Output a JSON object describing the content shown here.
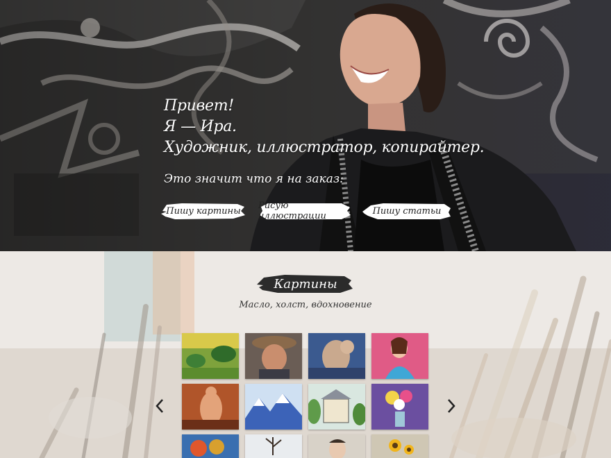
{
  "hero": {
    "greeting": "Привет!",
    "name_line": "Я — Ира.",
    "roles_line": "Художник, иллюстратор, копирайтер.",
    "subtitle": "Это значит что я на заказ:",
    "buttons": [
      {
        "label": "Пишу картины"
      },
      {
        "label": "Рисую иллюстрации"
      },
      {
        "label": "Пишу статьи"
      }
    ]
  },
  "paintings": {
    "title": "Картины",
    "subtitle": "Масло, холст, вдохновение",
    "prev_icon": "chevron-left-icon",
    "next_icon": "chevron-right-icon"
  },
  "colors": {
    "brush_white": "#ffffff",
    "brush_dark": "#2b2b2b"
  }
}
